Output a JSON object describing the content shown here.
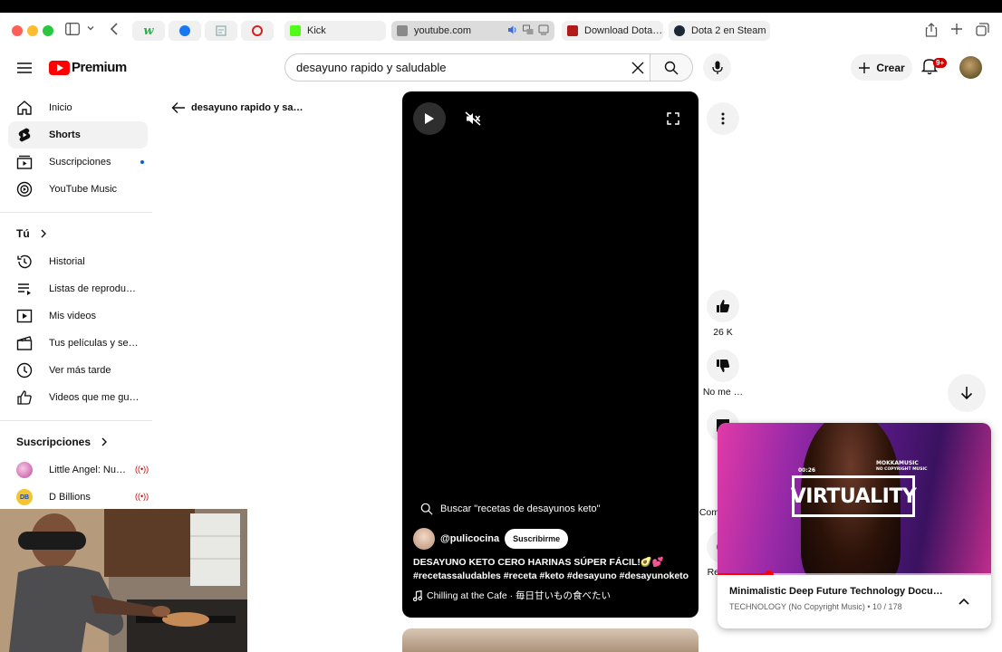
{
  "browser": {
    "tabs": [
      {
        "label": "Kick",
        "favicon_color": "#53fc18",
        "active": false
      },
      {
        "label": "youtube.com",
        "favicon_color": "#888888",
        "active": true
      },
      {
        "label": "Download Dota…",
        "favicon_color": "#b11b1b",
        "active": false
      },
      {
        "label": "Dota 2 en Steam",
        "favicon_color": "#1b2838",
        "active": false
      }
    ]
  },
  "header": {
    "logo_text": "Premium",
    "search_value": "desayuno rapido y saludable",
    "create_label": "Crear",
    "notification_count": "9+"
  },
  "sidebar": {
    "main_items": [
      {
        "label": "Inicio",
        "icon": "home-icon"
      },
      {
        "label": "Shorts",
        "icon": "shorts-icon"
      },
      {
        "label": "Suscripciones",
        "icon": "subscriptions-icon"
      },
      {
        "label": "YouTube Music",
        "icon": "music-icon"
      }
    ],
    "you_heading": "Tú",
    "you_items": [
      {
        "label": "Historial",
        "icon": "history-icon"
      },
      {
        "label": "Listas de reproducc…",
        "icon": "playlists-icon"
      },
      {
        "label": "Mis videos",
        "icon": "my-videos-icon"
      },
      {
        "label": "Tus películas y seri…",
        "icon": "movies-icon"
      },
      {
        "label": "Ver más tarde",
        "icon": "watch-later-icon"
      },
      {
        "label": "Videos que me gus…",
        "icon": "liked-icon"
      }
    ],
    "subscriptions_heading": "Suscripciones",
    "subscriptions": [
      {
        "label": "Little Angel: Nurs…"
      },
      {
        "label": "D Billions"
      }
    ]
  },
  "main": {
    "back_label": "desayuno rapido y sa…",
    "short": {
      "search_suggestion": "Buscar \"recetas de desayunos keto\"",
      "channel": "@pulicocina",
      "subscribe_label": "Suscribirme",
      "description_line1": "DESAYUNO KETO CERO HARINAS SÚPER FÁCIL!🥑💕",
      "description_line2": "#recetassaludables #receta #keto #desayuno #desayunoketo",
      "music": "Chilling at the Cafe · 毎日甘いもの食べたい"
    },
    "actions": {
      "likes": "26 K",
      "dislike_label": "No me …",
      "comments_label": "Com",
      "remix_label": "Re"
    }
  },
  "miniplayer": {
    "video_logo": "VIRTUALITY",
    "video_brand": "MOKKAMUSIC",
    "video_brand_sub": "NO COPYRIGHT MUSIC",
    "video_time": "00:26",
    "progress": 0.19,
    "title": "Minimalistic Deep Future Technology Document…",
    "channel": "TECHNOLOGY (No Copyright Music)",
    "playlist_position": "10 / 178"
  }
}
